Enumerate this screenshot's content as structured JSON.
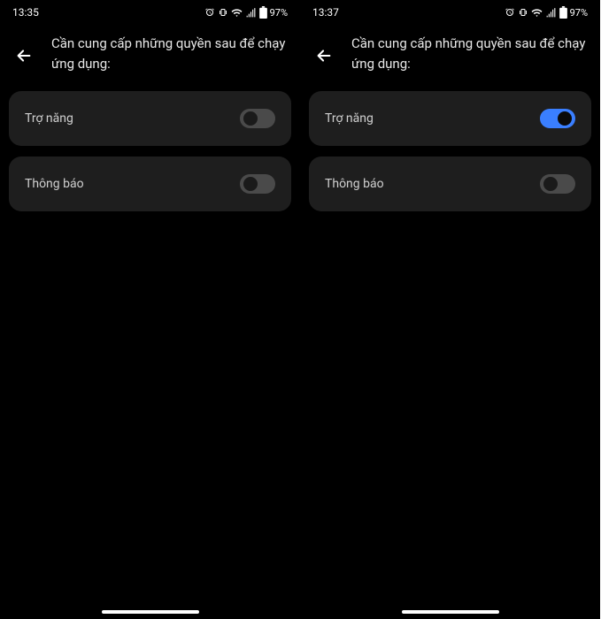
{
  "screens": [
    {
      "status": {
        "time": "13:35",
        "battery": "97%"
      },
      "title": "Cần cung cấp những quyền sau để chạy ứng dụng:",
      "settings": [
        {
          "label": "Trợ năng",
          "enabled": false
        },
        {
          "label": "Thông báo",
          "enabled": false
        }
      ]
    },
    {
      "status": {
        "time": "13:37",
        "battery": "97%"
      },
      "title": "Cần cung cấp những quyền sau để chạy ứng dụng:",
      "settings": [
        {
          "label": "Trợ năng",
          "enabled": true
        },
        {
          "label": "Thông báo",
          "enabled": false
        }
      ]
    }
  ]
}
